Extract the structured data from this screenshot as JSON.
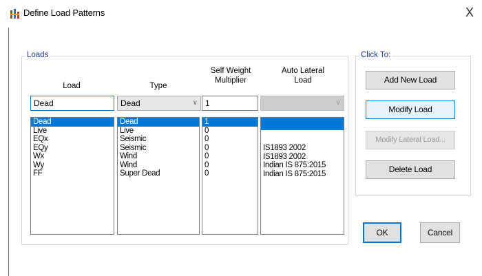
{
  "window": {
    "title": "Define Load Patterns",
    "icon": "etabs-app-icon",
    "close_glyph": "X"
  },
  "loads_group": {
    "label": "Loads",
    "headers": {
      "load": "Load",
      "type": "Type",
      "self_weight": "Self Weight Multiplier",
      "auto_lateral": "Auto Lateral Load"
    },
    "editors": {
      "load_name": "Dead",
      "type": "Dead",
      "multiplier": "1",
      "auto_lateral": ""
    },
    "rows": [
      {
        "load": "Dead",
        "type": "Dead",
        "multiplier": "1",
        "auto_lateral": ""
      },
      {
        "load": "Live",
        "type": "Live",
        "multiplier": "0",
        "auto_lateral": ""
      },
      {
        "load": "EQx",
        "type": "Seismic",
        "multiplier": "0",
        "auto_lateral": "IS1893 2002"
      },
      {
        "load": "EQy",
        "type": "Seismic",
        "multiplier": "0",
        "auto_lateral": "IS1893 2002"
      },
      {
        "load": "Wx",
        "type": "Wind",
        "multiplier": "0",
        "auto_lateral": "Indian IS 875:2015"
      },
      {
        "load": "Wy",
        "type": "Wind",
        "multiplier": "0",
        "auto_lateral": "Indian IS 875:2015"
      },
      {
        "load": "FF",
        "type": "Super Dead",
        "multiplier": "0",
        "auto_lateral": ""
      }
    ],
    "selected_index": 0
  },
  "click_to": {
    "label": "Click To:",
    "add_new_load": "Add New Load",
    "modify_load": "Modify Load",
    "modify_lateral_load": "Modify Lateral Load...",
    "delete_load": "Delete Load"
  },
  "ok": "OK",
  "cancel": "Cancel",
  "colors": {
    "selection": "#0078d7",
    "group_label": "#1e3d8f",
    "button_face": "#e1e1e1"
  }
}
